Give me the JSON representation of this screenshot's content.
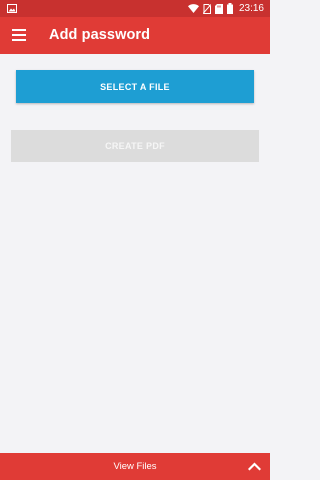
{
  "status_bar": {
    "time": "23:16",
    "icons": [
      "image-icon",
      "wifi-icon",
      "no-sim-icon",
      "sd-card-icon",
      "battery-icon"
    ]
  },
  "app_bar": {
    "title": "Add password",
    "menu_icon": "menu-icon"
  },
  "buttons": {
    "select_file_label": "SELECT A FILE",
    "create_pdf_label": "CREATE PDF"
  },
  "bottom_bar": {
    "label": "View Files",
    "icon": "chevron-up-icon"
  },
  "colors": {
    "status_bar": "#C8312F",
    "app_bar": "#E03B36",
    "select_button": "#1E9ED3",
    "create_button_disabled": "#DCDCDC",
    "background": "#F3F3F6"
  }
}
